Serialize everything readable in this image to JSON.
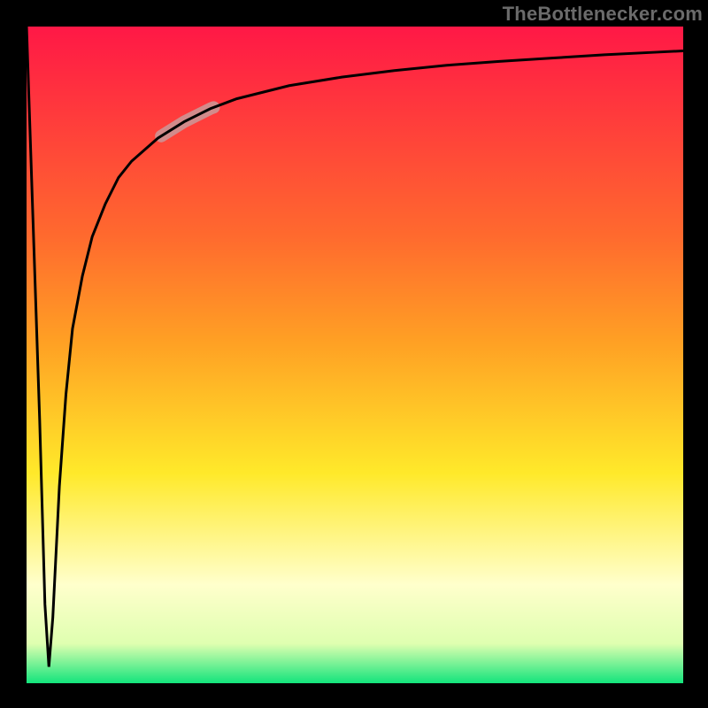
{
  "attribution": "TheBottlenecker.com",
  "colors": {
    "frame": "#000000",
    "top_red": "#ff1846",
    "mid_orange": "#ffa024",
    "mid_yellow": "#ffe92a",
    "near_bottom_yellowwhite": "#ffffcc",
    "bottom_green": "#13e47c",
    "curve": "#000000",
    "highlight": "#d28b8b"
  },
  "chart_data": {
    "type": "line",
    "title": "",
    "xlabel": "",
    "ylabel": "",
    "xlim": [
      0,
      100
    ],
    "ylim": [
      0,
      100
    ],
    "grid": false,
    "note": "Vertical gradient encodes bottleneck intensity: green (0) = balanced, red (100) = severe bottleneck. Black curve shows bottleneck % vs. an implicit x parameter. Values read from pixel positions.",
    "series": [
      {
        "name": "bottleneck-curve",
        "x": [
          0.0,
          1.0,
          2.0,
          2.8,
          3.4,
          4.0,
          5.0,
          6.0,
          7.0,
          8.5,
          10.0,
          12.0,
          14.0,
          16.0,
          20.0,
          24.0,
          28.0,
          32.0,
          40.0,
          48.0,
          56.0,
          64.0,
          72.0,
          80.0,
          88.0,
          96.0,
          100.0
        ],
        "values": [
          100.0,
          70.0,
          40.0,
          12.0,
          2.5,
          10.0,
          30.0,
          44.0,
          54.0,
          62.0,
          68.0,
          73.0,
          77.0,
          79.5,
          83.0,
          85.5,
          87.5,
          89.0,
          91.0,
          92.3,
          93.3,
          94.1,
          94.7,
          95.2,
          95.7,
          96.1,
          96.3
        ]
      }
    ],
    "highlight_segment": {
      "x_start": 20.5,
      "x_end": 28.5
    },
    "gradient_stops": [
      {
        "pct": 0,
        "color": "#ff1846"
      },
      {
        "pct": 32,
        "color": "#ff6a2e"
      },
      {
        "pct": 48,
        "color": "#ffa024"
      },
      {
        "pct": 68,
        "color": "#ffe92a"
      },
      {
        "pct": 85,
        "color": "#ffffcc"
      },
      {
        "pct": 94,
        "color": "#dfffb0"
      },
      {
        "pct": 100,
        "color": "#13e47c"
      }
    ]
  }
}
